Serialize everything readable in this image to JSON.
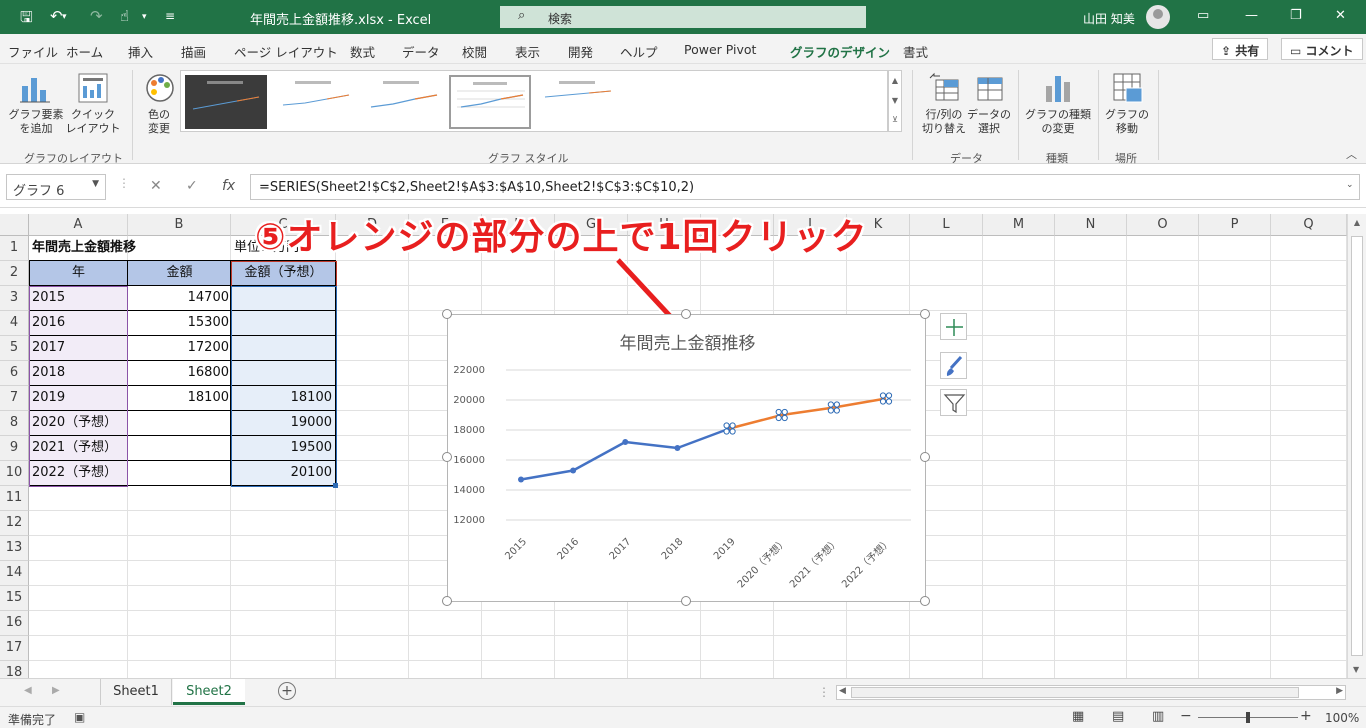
{
  "titlebar": {
    "file_title": "年間売上金額推移.xlsx  -  Excel",
    "search_label": "検索",
    "user_name": "山田 知美"
  },
  "menu": {
    "tabs": [
      "ファイル",
      "ホーム",
      "挿入",
      "描画",
      "ページ レイアウト",
      "数式",
      "データ",
      "校閲",
      "表示",
      "開発",
      "ヘルプ",
      "Power Pivot",
      "グラフのデザイン",
      "書式"
    ],
    "active_tab": "グラフのデザイン",
    "share_label": "共有",
    "comment_label": "コメント"
  },
  "ribbon": {
    "add_element_l1": "グラフ要素",
    "add_element_l2": "を追加",
    "quick_layout_l1": "クイック",
    "quick_layout_l2": "レイアウト",
    "group_layout": "グラフのレイアウト",
    "change_color_l1": "色の",
    "change_color_l2": "変更",
    "group_styles": "グラフ スタイル",
    "switch_l1": "行/列の",
    "switch_l2": "切り替え",
    "select_data_l1": "データの",
    "select_data_l2": "選択",
    "group_data": "データ",
    "change_type_l1": "グラフの種類",
    "change_type_l2": "の変更",
    "group_type": "種類",
    "move_l1": "グラフの",
    "move_l2": "移動",
    "group_location": "場所"
  },
  "formula_bar": {
    "name_box": "グラフ 6",
    "formula": "=SERIES(Sheet2!$C$2,Sheet2!$A$3:$A$10,Sheet2!$C$3:$C$10,2)"
  },
  "grid": {
    "columns": [
      "A",
      "B",
      "C",
      "D",
      "E",
      "F",
      "G",
      "H",
      "I",
      "J",
      "K",
      "L",
      "M",
      "N",
      "O",
      "P",
      "Q"
    ],
    "rows": [
      "1",
      "2",
      "3",
      "4",
      "5",
      "6",
      "7",
      "8",
      "9",
      "10",
      "11",
      "12",
      "13",
      "14",
      "15",
      "16",
      "17",
      "18"
    ],
    "a1": "年間売上金額推移",
    "c1": "単位：万円",
    "headers": [
      "年",
      "金額",
      "金額（予想）"
    ],
    "data": [
      [
        "2015",
        "14700",
        ""
      ],
      [
        "2016",
        "15300",
        ""
      ],
      [
        "2017",
        "17200",
        ""
      ],
      [
        "2018",
        "16800",
        ""
      ],
      [
        "2019",
        "18100",
        "18100"
      ],
      [
        "2020（予想）",
        "",
        "19000"
      ],
      [
        "2021（予想）",
        "",
        "19500"
      ],
      [
        "2022（予想）",
        "",
        "20100"
      ]
    ]
  },
  "annotation": "⑤オレンジの部分の上で1回クリック",
  "chart_data": {
    "type": "line",
    "title": "年間売上金額推移",
    "categories": [
      "2015",
      "2016",
      "2017",
      "2018",
      "2019",
      "2020（予想）",
      "2021（予想）",
      "2022（予想）"
    ],
    "series": [
      {
        "name": "金額",
        "color": "#4472c4",
        "values": [
          14700,
          15300,
          17200,
          16800,
          18100,
          null,
          null,
          null
        ]
      },
      {
        "name": "金額（予想）",
        "color": "#ed7d31",
        "values": [
          null,
          null,
          null,
          null,
          18100,
          19000,
          19500,
          20100
        ]
      }
    ],
    "yticks": [
      "12000",
      "14000",
      "16000",
      "18000",
      "20000",
      "22000"
    ],
    "ylim": [
      12000,
      22000
    ],
    "grid": true,
    "legend": "none"
  },
  "sheets": {
    "tabs": [
      "Sheet1",
      "Sheet2"
    ],
    "active": "Sheet2"
  },
  "status": {
    "ready": "準備完了",
    "zoom": "100%"
  },
  "colors": {
    "excel_green": "#217346",
    "series1": "#4472c4",
    "series2": "#ed7d31",
    "annotation_red": "#e81f1f"
  }
}
